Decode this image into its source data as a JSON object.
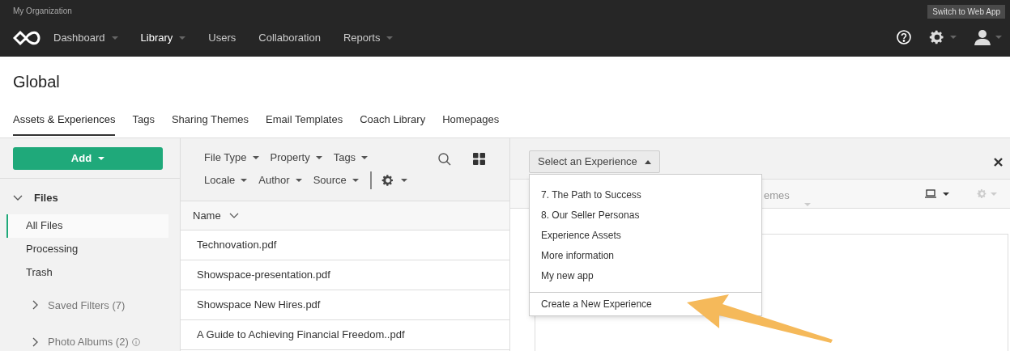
{
  "org": "My Organization",
  "switch_button": "Switch to Web App",
  "nav": [
    {
      "label": "Dashboard",
      "selected": false,
      "dropdown": true
    },
    {
      "label": "Library",
      "selected": true,
      "dropdown": true
    },
    {
      "label": "Users",
      "selected": false,
      "dropdown": false
    },
    {
      "label": "Collaboration",
      "selected": false,
      "dropdown": false
    },
    {
      "label": "Reports",
      "selected": false,
      "dropdown": true
    }
  ],
  "page_title": "Global",
  "tabs": [
    {
      "label": "Assets & Experiences",
      "selected": true
    },
    {
      "label": "Tags",
      "selected": false
    },
    {
      "label": "Sharing Themes",
      "selected": false
    },
    {
      "label": "Email Templates",
      "selected": false
    },
    {
      "label": "Coach Library",
      "selected": false
    },
    {
      "label": "Homepages",
      "selected": false
    }
  ],
  "sidebar": {
    "add_button": "Add",
    "section": {
      "label": "Files",
      "expanded": true
    },
    "items": [
      {
        "label": "All Files",
        "selected": true
      },
      {
        "label": "Processing",
        "selected": false
      },
      {
        "label": "Trash",
        "selected": false
      }
    ],
    "groups": [
      {
        "label": "Saved Filters (7)",
        "info": false
      },
      {
        "label": "Photo Albums (2)",
        "info": true
      }
    ]
  },
  "filters": [
    [
      "File Type",
      "Property",
      "Tags"
    ],
    [
      "Locale",
      "Author",
      "Source"
    ]
  ],
  "table": {
    "column": "Name",
    "rows": [
      "Technovation.pdf",
      "Showspace-presentation.pdf",
      "Showspace New Hires.pdf",
      "A Guide to Achieving Financial Freedom..pdf"
    ]
  },
  "experience": {
    "select_label": "Select an Experience",
    "expanded": true,
    "hidden_label": "emes",
    "options": [
      "7. The Path to Success",
      "8. Our Seller Personas",
      "Experience Assets",
      "More information",
      "My new app"
    ],
    "create": "Create a New Experience"
  }
}
